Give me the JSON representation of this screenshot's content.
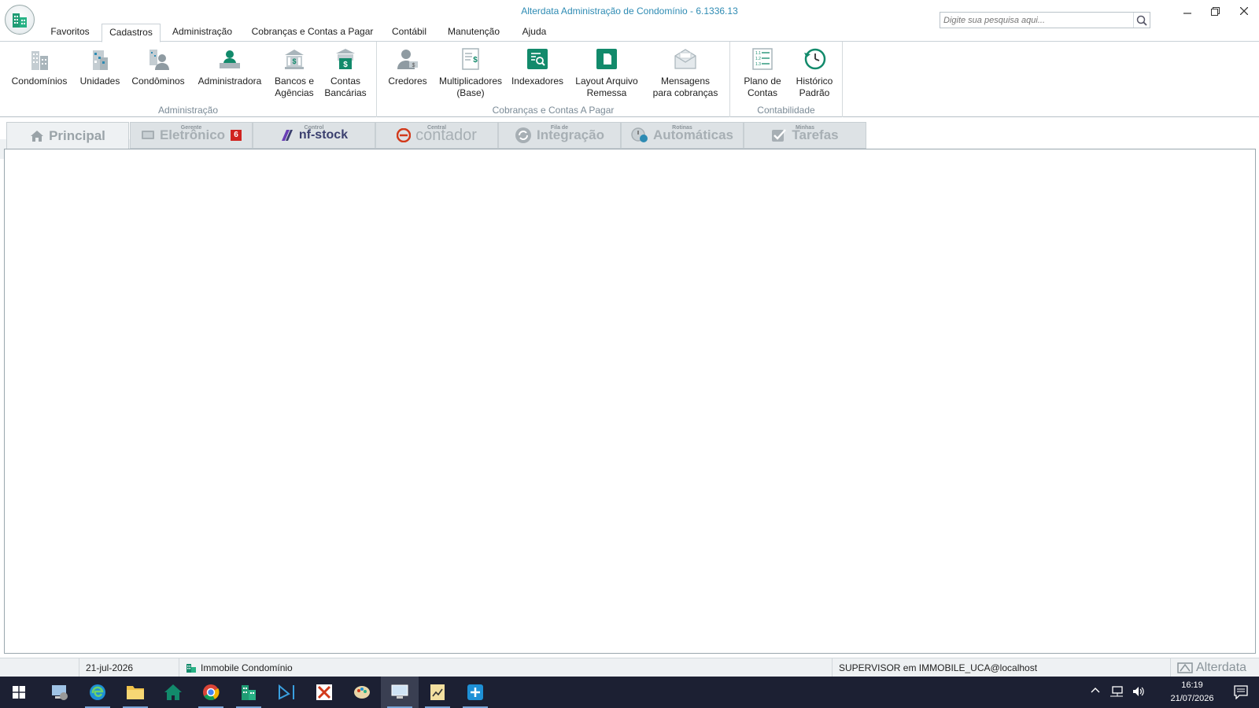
{
  "window": {
    "title": "Alterdata Administração de Condomínio - 6.1336.13",
    "search_placeholder": "Digite sua pesquisa aqui..."
  },
  "menu": {
    "tabs": [
      "Favoritos",
      "Cadastros",
      "Administração",
      "Cobranças e Contas a Pagar",
      "Contábil",
      "Manutenção",
      "Ajuda"
    ],
    "active": "Cadastros"
  },
  "ribbon": {
    "groups": [
      {
        "label": "Administração",
        "buttons": [
          "Condomínios",
          "Unidades",
          "Condôminos",
          "Administradora",
          "Bancos e\nAgências",
          "Contas\nBancárias"
        ]
      },
      {
        "label": "Cobranças e Contas A Pagar",
        "buttons": [
          "Credores",
          "Multiplicadores\n(Base)",
          "Indexadores",
          "Layout Arquivo\nRemessa",
          "Mensagens\npara cobranças"
        ]
      },
      {
        "label": "Contabilidade",
        "buttons": [
          "Plano de\nContas",
          "Histórico\nPadrão"
        ]
      }
    ]
  },
  "subtabs": [
    {
      "sup": "",
      "label": "Principal",
      "icon": "home-icon"
    },
    {
      "sup": "Gerente",
      "label": "Eletrônico",
      "badge": "6",
      "icon": "monitor-icon"
    },
    {
      "sup": "Control",
      "label": "nf-stock",
      "icon": "nfstock-logo"
    },
    {
      "sup": "Central",
      "label": "contador",
      "icon": "e-logo"
    },
    {
      "sup": "Fila de",
      "label": "Integração",
      "icon": "sync-icon"
    },
    {
      "sup": "Rotinas",
      "label": "Automáticas",
      "icon": "clock-gear-icon"
    },
    {
      "sup": "Minhas",
      "label": "Tarefas",
      "icon": "check-icon"
    }
  ],
  "status": {
    "date": "21-jul-2026",
    "company": "Immobile Condomínio",
    "user": "SUPERVISOR em IMMOBILE_UCA@localhost",
    "brand": "Alterdata"
  },
  "taskbar": {
    "time": "16:19",
    "date": "21/07/2026"
  },
  "colors": {
    "accent_teal": "#128a6b",
    "title_blue": "#2e8bb3",
    "badge_red": "#d0231f",
    "taskbar": "#1c2033"
  }
}
